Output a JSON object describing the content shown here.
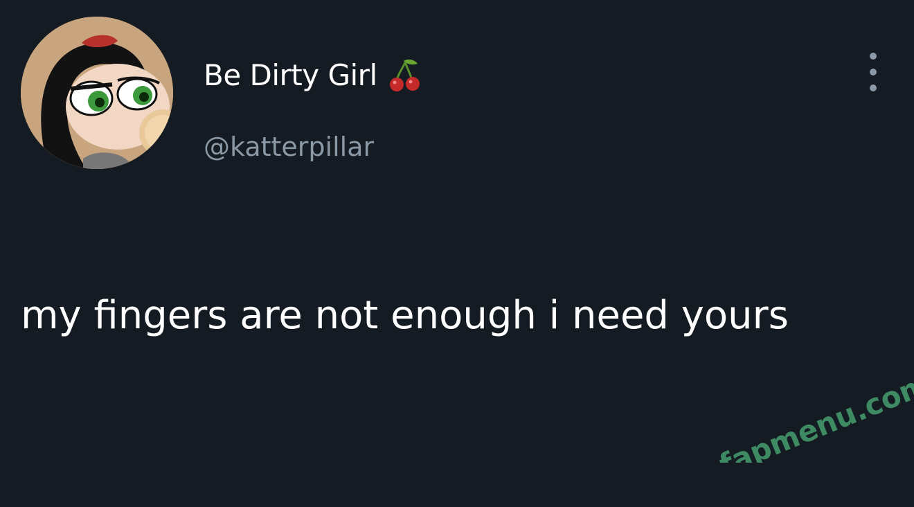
{
  "author": {
    "display_name": "Be Dirty Girl",
    "handle": "@katterpillar",
    "avatar_icon": "cartoon-avatar",
    "badge_icon": "cherry-emoji"
  },
  "tweet": {
    "text": "my fingers are not enough i need yours"
  },
  "menu": {
    "icon": "more-vertical-icon"
  },
  "watermark": {
    "text": "fapmenu.com",
    "color": "#3e8a63"
  },
  "colors": {
    "background": "#141b22",
    "primary_text": "#ffffff",
    "secondary_text": "#8b98a5"
  }
}
